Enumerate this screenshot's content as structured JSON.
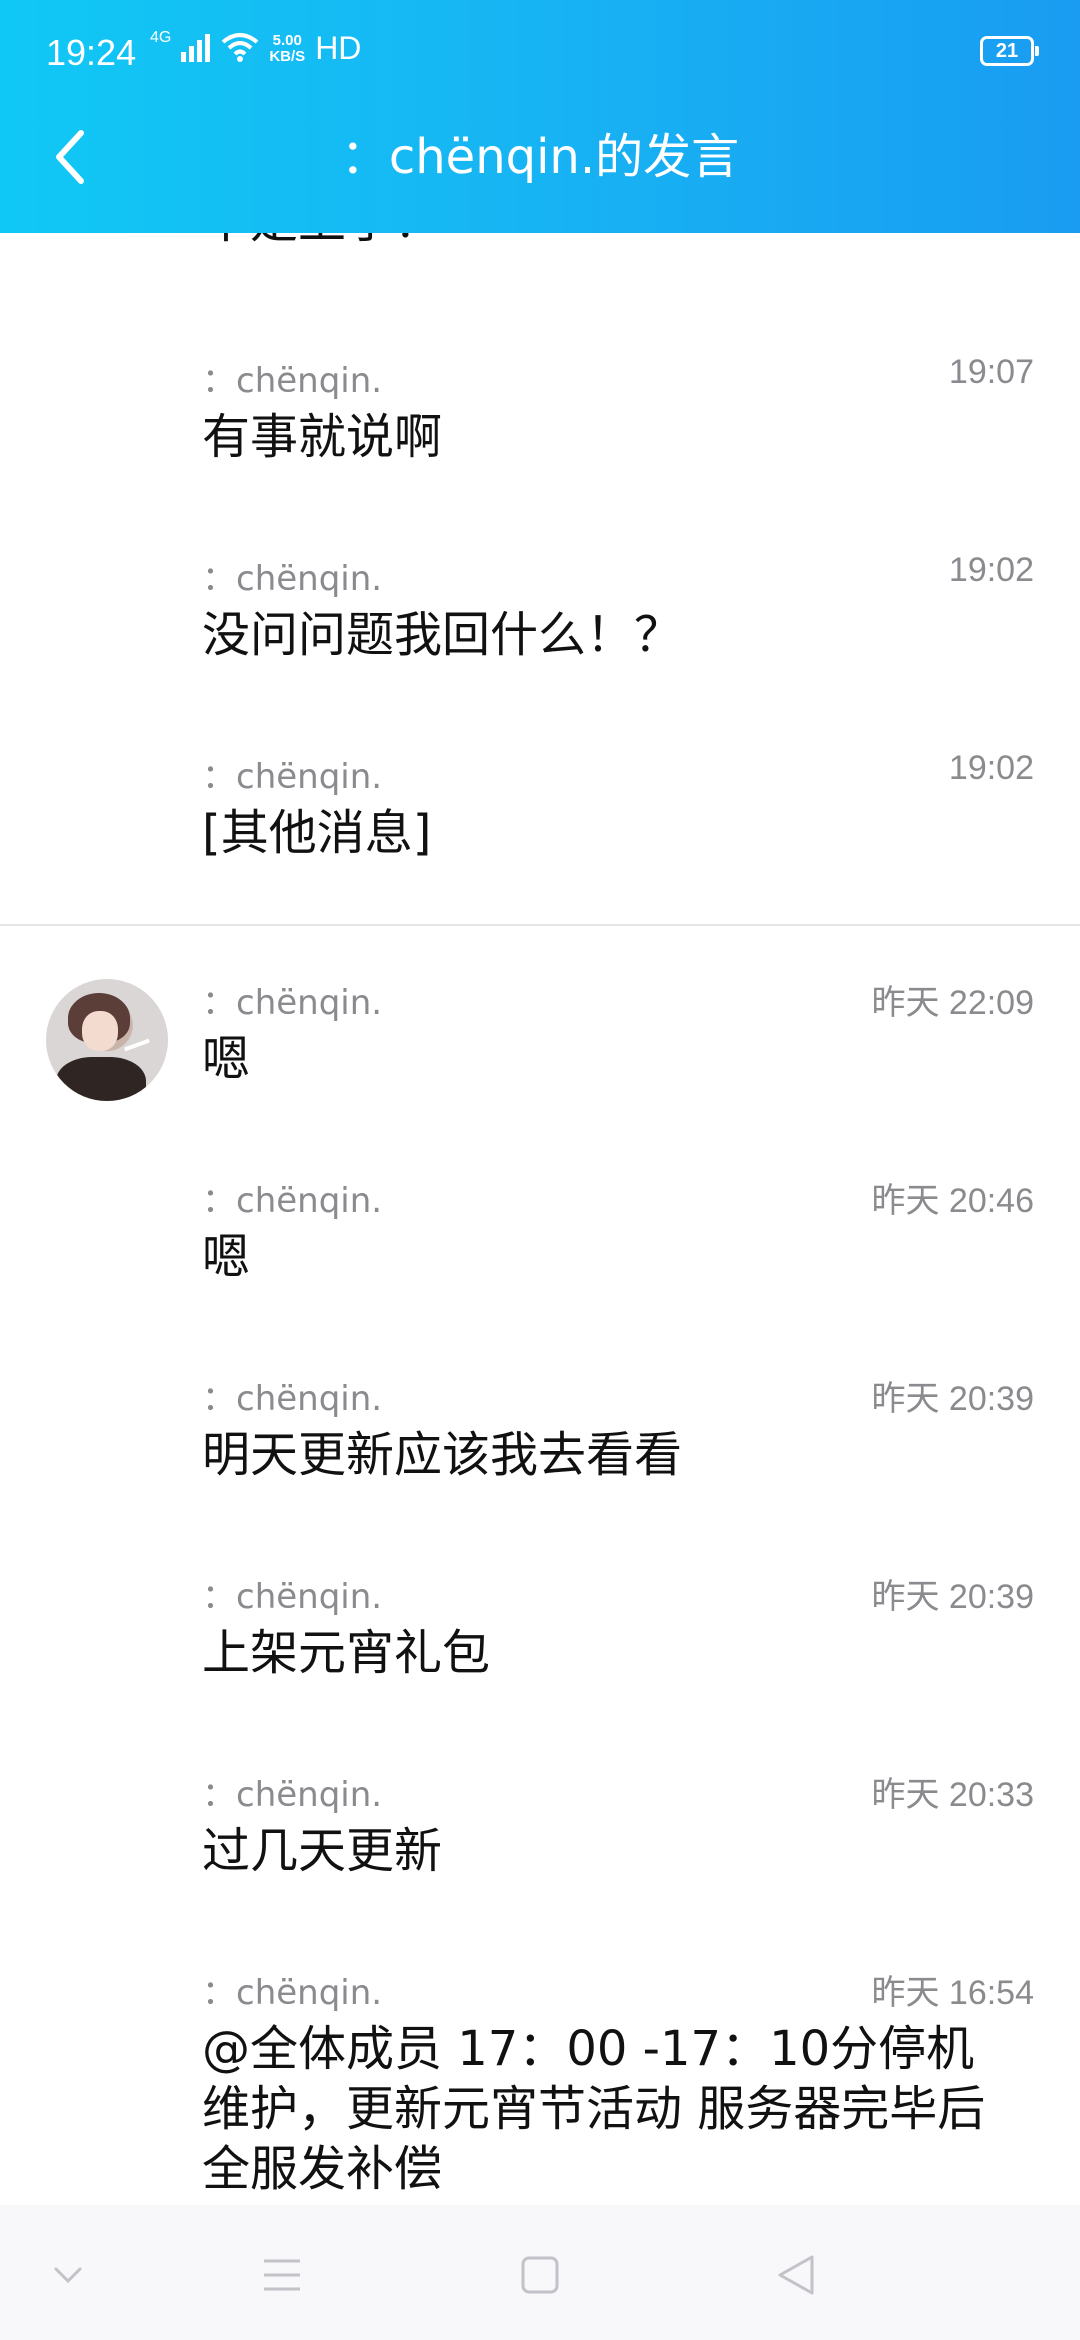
{
  "status_bar": {
    "time": "19:24",
    "network": "4G",
    "speed_value": "5.00",
    "speed_unit": "KB/S",
    "hd": "HD",
    "battery": "21"
  },
  "header": {
    "title": "：chënqin.的发言",
    "back_icon": "chevron-left-icon"
  },
  "messages": [
    {
      "sender": "",
      "time": "",
      "text": "不是上了？"
    },
    {
      "sender": "：chënqin.",
      "time": "19:07",
      "text": "有事就说啊"
    },
    {
      "sender": "：chënqin.",
      "time": "19:02",
      "text": "没问问题我回什么！？"
    },
    {
      "sender": "：chënqin.",
      "time": "19:02",
      "text": "[其他消息]"
    },
    {
      "sender": "：chënqin.",
      "time": "昨天 22:09",
      "text": "嗯"
    },
    {
      "sender": "：chënqin.",
      "time": "昨天 20:46",
      "text": "嗯"
    },
    {
      "sender": "：chënqin.",
      "time": "昨天 20:39",
      "text": "明天更新应该我去看看"
    },
    {
      "sender": "：chënqin.",
      "time": "昨天 20:39",
      "text": "上架元宵礼包"
    },
    {
      "sender": "：chënqin.",
      "time": "昨天 20:33",
      "text": "过几天更新"
    },
    {
      "sender": "：chënqin.",
      "time": "昨天 16:54",
      "text": "@全体成员  17：00 -17：10分停机维护，更新元宵节活动  服务器完毕后全服发补偿"
    }
  ],
  "nav_bar": {
    "icons": [
      "chevron-down-icon",
      "menu-icon",
      "home-square-icon",
      "back-triangle-icon"
    ]
  },
  "colors": {
    "header_start": "#10c8f5",
    "header_end": "#199cf2",
    "meta_text": "#8a8a8f",
    "body_text": "#111111"
  }
}
